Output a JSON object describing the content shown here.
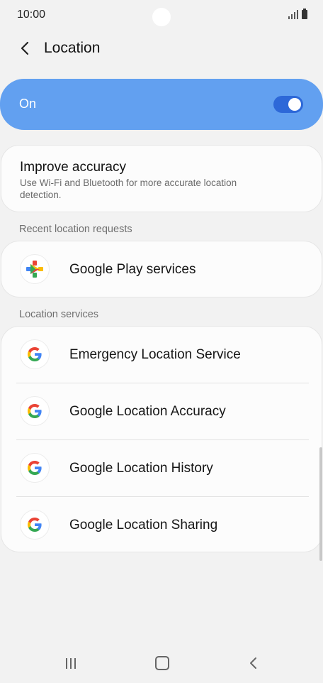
{
  "status_bar": {
    "time": "10:00",
    "signal_icon": "signal-icon",
    "battery_icon": "battery-icon"
  },
  "header": {
    "back_icon": "back-arrow-icon",
    "title": "Location"
  },
  "master_toggle": {
    "label": "On",
    "state": "on",
    "accent_color": "#62a0f0",
    "switch_color": "#2d68d8"
  },
  "improve_accuracy": {
    "title": "Improve accuracy",
    "description": "Use Wi-Fi and Bluetooth for more accurate location detection."
  },
  "recent_requests": {
    "header": "Recent location requests",
    "items": [
      {
        "label": "Google Play services",
        "icon": "google-play-services-icon"
      }
    ]
  },
  "location_services": {
    "header": "Location services",
    "items": [
      {
        "label": "Emergency Location Service",
        "icon": "google-g-icon"
      },
      {
        "label": "Google Location Accuracy",
        "icon": "google-g-icon"
      },
      {
        "label": "Google Location History",
        "icon": "google-g-icon"
      },
      {
        "label": "Google Location Sharing",
        "icon": "google-g-icon"
      }
    ]
  },
  "nav_bar": {
    "recents_icon": "recents-icon",
    "home_icon": "home-icon",
    "back_icon": "nav-back-icon"
  }
}
